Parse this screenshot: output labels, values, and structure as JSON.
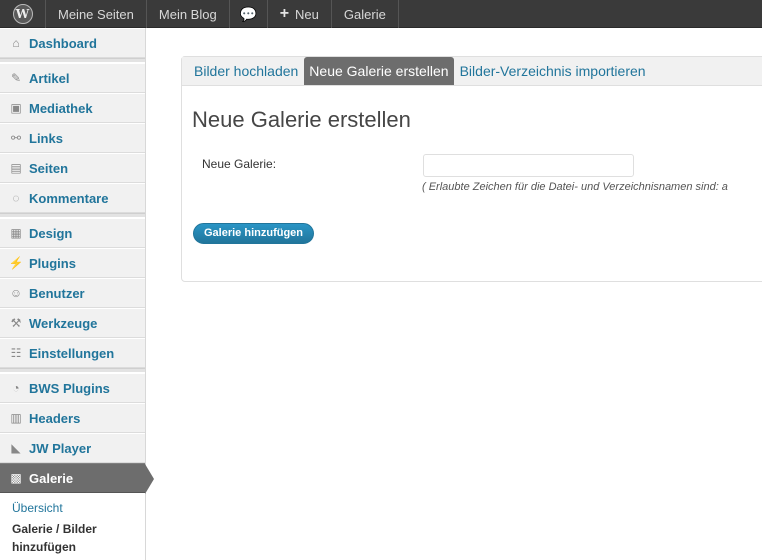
{
  "adminbar": {
    "logo_glyph": "W",
    "site_label": "Meine Seiten",
    "blog_label": "Mein Blog",
    "comment_glyph": "💬",
    "new_glyph": "+",
    "new_label": "Neu",
    "gallery_label": "Galerie"
  },
  "sidebar": {
    "items": [
      {
        "label": "Dashboard",
        "icon": "⌂"
      },
      {
        "label": "Artikel",
        "icon": "✎"
      },
      {
        "label": "Mediathek",
        "icon": "▣"
      },
      {
        "label": "Links",
        "icon": "⚯"
      },
      {
        "label": "Seiten",
        "icon": "▤"
      },
      {
        "label": "Kommentare",
        "icon": "◌"
      },
      {
        "label": "Design",
        "icon": "▦"
      },
      {
        "label": "Plugins",
        "icon": "⚡"
      },
      {
        "label": "Benutzer",
        "icon": "☺"
      },
      {
        "label": "Werkzeuge",
        "icon": "⚒"
      },
      {
        "label": "Einstellungen",
        "icon": "☷"
      },
      {
        "label": "BWS Plugins",
        "icon": "◔"
      },
      {
        "label": "Headers",
        "icon": "▥"
      },
      {
        "label": "JW Player",
        "icon": "◣"
      },
      {
        "label": "Galerie",
        "icon": "▩"
      }
    ],
    "submenu": {
      "overview": "Übersicht",
      "current": "Galerie / Bilder hinzufügen"
    }
  },
  "tabs": [
    "Bilder hochladen",
    "Neue Galerie erstellen",
    "Bilder-Verzeichnis importieren"
  ],
  "main": {
    "title": "Neue Galerie erstellen",
    "field_label": "Neue Galerie:",
    "field_value": "",
    "hint": "( Erlaubte Zeichen für die Datei- und Verzeichnisnamen sind: a",
    "submit_label": "Galerie hinzufügen"
  },
  "colors": {
    "accent": "#21759b",
    "adminbar": "#3a3a3a",
    "active_menu": "#6d6d6d"
  }
}
